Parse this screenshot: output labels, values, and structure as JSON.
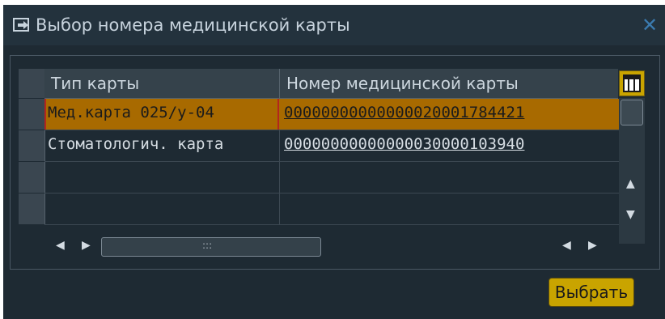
{
  "dialog": {
    "title": "Выбор номера медицинской карты",
    "close_glyph": "✕",
    "title_icon": "dialog-icon",
    "accent_color": "#c9a400"
  },
  "table": {
    "headers": [
      "Тип карты",
      "Номер медицинской карты"
    ],
    "rows": [
      {
        "type": "Мед.карта 025/у-04",
        "number": "00000000000000020001784421",
        "selected": true
      },
      {
        "type": "Стоматологич. карта",
        "number": "00000000000000030000103940",
        "selected": false
      },
      {
        "type": "",
        "number": "",
        "selected": false
      },
      {
        "type": "",
        "number": "",
        "selected": false
      }
    ]
  },
  "footer": {
    "select_label": "Выбрать"
  }
}
